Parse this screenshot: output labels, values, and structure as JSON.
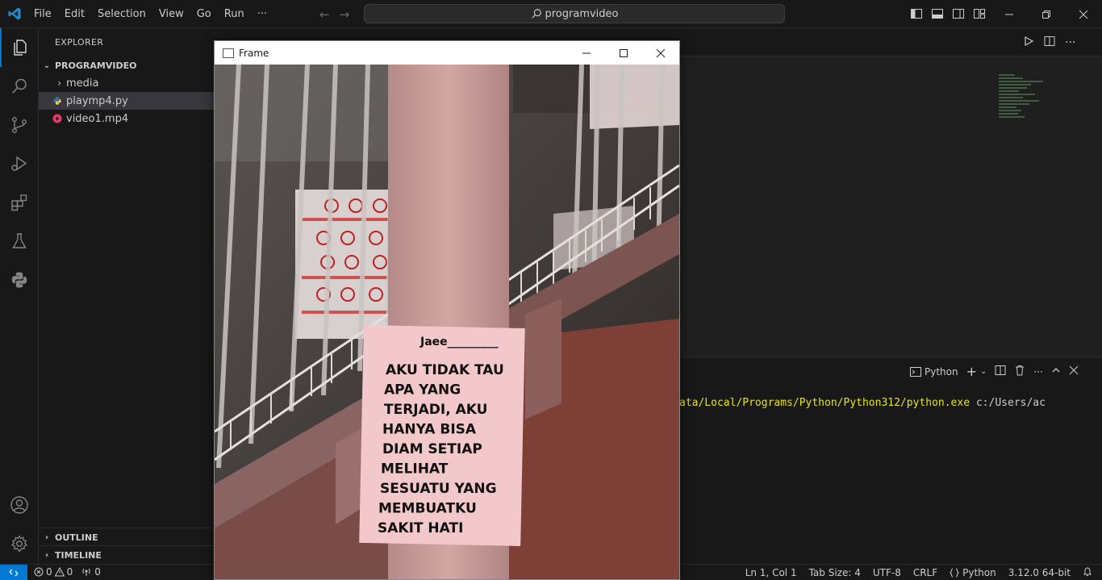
{
  "menu": [
    "File",
    "Edit",
    "Selection",
    "View",
    "Go",
    "Run",
    "···"
  ],
  "command_center": {
    "label": "programvideo"
  },
  "sidebar": {
    "title": "EXPLORER",
    "folder": "PROGRAMVIDEO",
    "items": [
      {
        "label": "media",
        "type": "folder"
      },
      {
        "label": "playmp4.py",
        "type": "python"
      },
      {
        "label": "video1.mp4",
        "type": "video"
      }
    ],
    "outline": "OUTLINE",
    "timeline": "TIMELINE"
  },
  "panel": {
    "terminal_name": "Python",
    "terminal_path": "ata/Local/Programs/Python/Python312/python.exe",
    "terminal_arg": " c:/Users/ac"
  },
  "frame_window": {
    "title": "Frame",
    "poster": {
      "header": "Jaee_________",
      "lines": [
        "AKU TIDAK TAU",
        "APA YANG",
        "TERJADI, AKU",
        "HANYA BISA",
        "DIAM SETIAP",
        "MELIHAT",
        "SESUATU YANG",
        "MEMBUATKU",
        "SAKIT HATI"
      ]
    }
  },
  "statusbar": {
    "errors": "0",
    "warnings": "0",
    "ports": "0",
    "position": "Ln 1, Col 1",
    "tab_size": "Tab Size: 4",
    "encoding": "UTF-8",
    "eol": "CRLF",
    "language": "Python",
    "interpreter": "3.12.0 64-bit"
  },
  "colors": {
    "accent": "#0078d4",
    "terminal_path": "#e5e510",
    "background": "#1f1f1f"
  }
}
